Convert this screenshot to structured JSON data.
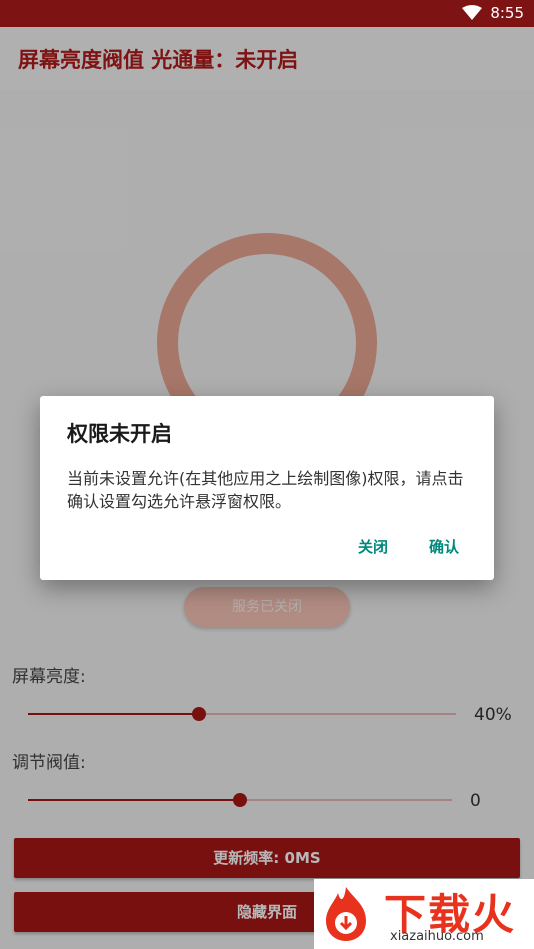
{
  "status_bar": {
    "time": "8:55",
    "wifi_icon": "wifi-icon"
  },
  "app_bar": {
    "title": "屏幕亮度阀值 光通量：未开启"
  },
  "main": {
    "service_button": "服务已关闭",
    "brightness": {
      "label": "屏幕亮度:",
      "value_text": "40%",
      "level": 0.4
    },
    "threshold": {
      "label": "调节阀值:",
      "value_text": "0",
      "level": 0.5
    },
    "refresh_button": "更新频率: 0MS",
    "hide_button": "隐藏界面"
  },
  "dialog": {
    "title": "权限未开启",
    "message": "当前未设置允许(在其他应用之上绘制图像)权限，请点击确认设置勾选允许悬浮窗权限。",
    "close_label": "关闭",
    "confirm_label": "确认"
  },
  "watermark": {
    "brand": "下载火",
    "url": "xiazaihuo.com"
  },
  "colors": {
    "accent": "#a81717",
    "dialog_button": "#00897b",
    "status_bar": "#7d1313"
  }
}
